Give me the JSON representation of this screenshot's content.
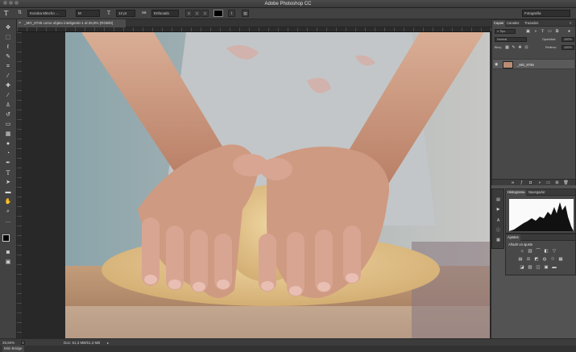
{
  "window": {
    "title": "Adobe Photoshop CC"
  },
  "options_bar": {
    "font_family": "Kozuka Mincho ...",
    "font_style": "M",
    "font_size": "12 pt",
    "aa_icon": "aa",
    "aa_mode": "Enfocado",
    "workspace": "Fotografía"
  },
  "document": {
    "tab_title": "_MG_8745 como objeto inteligente-1 al 25,8% (RGB/8)",
    "canvas_colors": {
      "bg_dark": "#8a9ea3",
      "skin": "#c99a80",
      "dough": "#e2c78f",
      "table": "#b59070",
      "apron": "#bfc3c6"
    }
  },
  "status": {
    "zoom": "25,84%",
    "doc_info": "Doc: 51,3 MB/51,3 MB"
  },
  "mini_bridge": {
    "label": "Mini Bridge"
  },
  "layers_panel": {
    "tabs": [
      "Capas",
      "Canales",
      "Trazados"
    ],
    "filter": "Tipo",
    "blend_mode": "Normal",
    "opacity_label": "Opacidad:",
    "opacity_value": "100%",
    "lock_label": "Bloq:",
    "fill_label": "Relleno:",
    "fill_value": "100%",
    "layer_name": "_MG_8745"
  },
  "histogram_panel": {
    "tabs": [
      "Histograma",
      "Navegador"
    ]
  },
  "adjustments_panel": {
    "tab": "Ajustes",
    "title": "Añadir un ajuste"
  }
}
